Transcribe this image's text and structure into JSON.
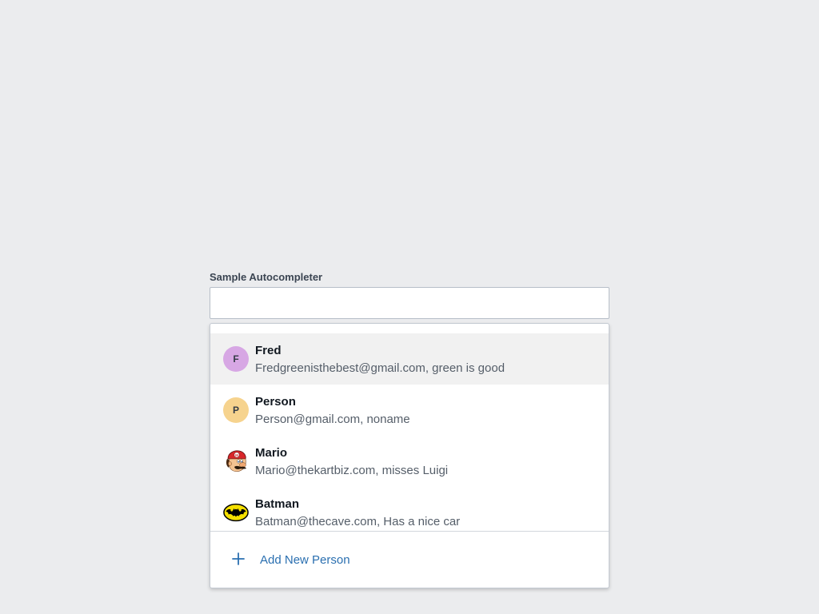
{
  "field": {
    "label": "Sample Autocompleter",
    "value": "",
    "placeholder": ""
  },
  "options": [
    {
      "name": "Fred",
      "detail": "Fredgreenisthebest@gmail.com, green is good",
      "avatar_letter": "F",
      "avatar_color": "#d7a7e4",
      "highlighted": true
    },
    {
      "name": "Person",
      "detail": "Person@gmail.com, noname",
      "avatar_letter": "P",
      "avatar_color": "#f6d38e",
      "highlighted": false
    },
    {
      "name": "Mario",
      "detail": "Mario@thekartbiz.com, misses Luigi",
      "avatar_icon": "mario-face-icon",
      "highlighted": false
    },
    {
      "name": "Batman",
      "detail": "Batman@thecave.com, Has a nice car",
      "avatar_icon": "bat-logo-icon",
      "highlighted": false
    }
  ],
  "add_action": {
    "label": "Add New Person",
    "icon": "plus-icon"
  },
  "colors": {
    "page_background": "#ebecee",
    "highlight_row": "#f1f1f1",
    "link": "#2a6fb0"
  }
}
